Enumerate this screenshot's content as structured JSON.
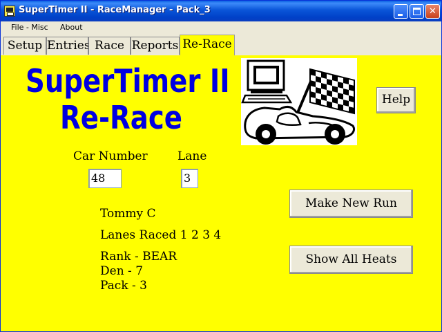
{
  "window": {
    "title": "SuperTimer II - RaceManager - Pack_3"
  },
  "menu": {
    "items": [
      "File - Misc",
      "About"
    ]
  },
  "tabs": [
    {
      "label": "Setup",
      "active": false
    },
    {
      "label": "Entries",
      "active": false
    },
    {
      "label": "Race",
      "active": false
    },
    {
      "label": "Reports",
      "active": false
    },
    {
      "label": "Re-Race",
      "active": true
    }
  ],
  "header": {
    "line1": "SuperTimer II",
    "line2": "Re-Race"
  },
  "help_label": "Help",
  "form": {
    "car_number_label": "Car Number",
    "car_number_value": "48",
    "lane_label": "Lane",
    "lane_value": "3"
  },
  "racer": {
    "name": "Tommy C",
    "lanes_raced": "Lanes Raced 1 2 3 4",
    "rank": "Rank - BEAR",
    "den": "Den - 7",
    "pack": "Pack - 3"
  },
  "actions": {
    "make_new_run": "Make New Run",
    "show_all_heats": "Show All Heats"
  },
  "colors": {
    "panel": "#ffff00",
    "title_text": "#0000e0",
    "titlebar": "#0a55d8"
  }
}
